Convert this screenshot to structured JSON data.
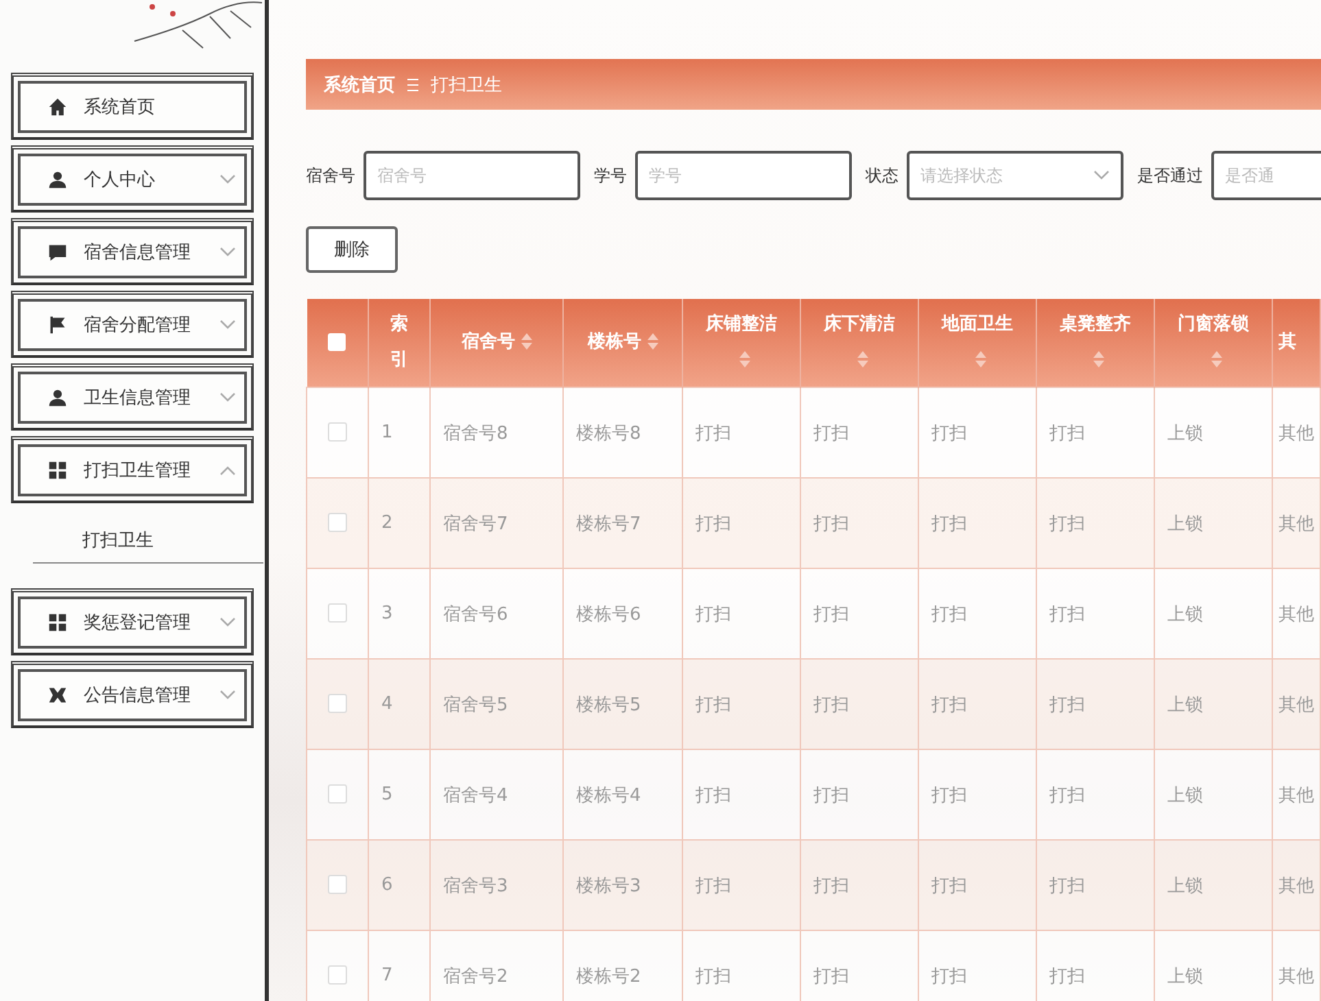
{
  "sidebar": {
    "items": [
      {
        "label": "系统首页",
        "kind": "link"
      },
      {
        "label": "个人中心",
        "kind": "menu",
        "expanded": false
      },
      {
        "label": "宿舍信息管理",
        "kind": "menu",
        "expanded": false
      },
      {
        "label": "宿舍分配管理",
        "kind": "menu",
        "expanded": false
      },
      {
        "label": "卫生信息管理",
        "kind": "menu",
        "expanded": false
      },
      {
        "label": "打扫卫生管理",
        "kind": "menu",
        "expanded": true,
        "children": [
          {
            "label": "打扫卫生"
          }
        ]
      },
      {
        "label": "奖惩登记管理",
        "kind": "menu",
        "expanded": false
      },
      {
        "label": "公告信息管理",
        "kind": "menu",
        "expanded": false
      }
    ]
  },
  "breadcrumb": [
    "系统首页",
    "打扫卫生"
  ],
  "filters": [
    {
      "label": "宿舍号",
      "placeholder": "宿舍号",
      "kind": "input"
    },
    {
      "label": "学号",
      "placeholder": "学号",
      "kind": "input"
    },
    {
      "label": "状态",
      "placeholder": "请选择状态",
      "kind": "select"
    },
    {
      "label": "是否通过",
      "placeholder": "是否通",
      "kind": "input"
    }
  ],
  "buttons": [
    "删除"
  ],
  "table": {
    "select_all": {
      "checked": false
    },
    "columns": [
      {
        "label": "索引",
        "sortable": false
      },
      {
        "label": "宿舍号",
        "sortable": true
      },
      {
        "label": "楼栋号",
        "sortable": true
      },
      {
        "label": "床铺整洁",
        "sortable": true
      },
      {
        "label": "床下清洁",
        "sortable": true
      },
      {
        "label": "地面卫生",
        "sortable": true
      },
      {
        "label": "桌凳整齐",
        "sortable": true
      },
      {
        "label": "门窗落锁",
        "sortable": true
      },
      {
        "label": "其",
        "sortable": false
      }
    ],
    "rows": [
      {
        "checked": false,
        "cells": [
          "1",
          "宿舍号8",
          "楼栋号8",
          "打扫",
          "打扫",
          "打扫",
          "打扫",
          "上锁",
          "其他"
        ]
      },
      {
        "checked": false,
        "cells": [
          "2",
          "宿舍号7",
          "楼栋号7",
          "打扫",
          "打扫",
          "打扫",
          "打扫",
          "上锁",
          "其他"
        ]
      },
      {
        "checked": false,
        "cells": [
          "3",
          "宿舍号6",
          "楼栋号6",
          "打扫",
          "打扫",
          "打扫",
          "打扫",
          "上锁",
          "其他"
        ]
      },
      {
        "checked": false,
        "cells": [
          "4",
          "宿舍号5",
          "楼栋号5",
          "打扫",
          "打扫",
          "打扫",
          "打扫",
          "上锁",
          "其他"
        ]
      },
      {
        "checked": false,
        "cells": [
          "5",
          "宿舍号4",
          "楼栋号4",
          "打扫",
          "打扫",
          "打扫",
          "打扫",
          "上锁",
          "其他"
        ]
      },
      {
        "checked": false,
        "cells": [
          "6",
          "宿舍号3",
          "楼栋号3",
          "打扫",
          "打扫",
          "打扫",
          "打扫",
          "上锁",
          "其他"
        ]
      },
      {
        "checked": false,
        "cells": [
          "7",
          "宿舍号2",
          "楼栋号2",
          "打扫",
          "打扫",
          "打扫",
          "打扫",
          "上锁",
          "其他"
        ]
      }
    ]
  }
}
